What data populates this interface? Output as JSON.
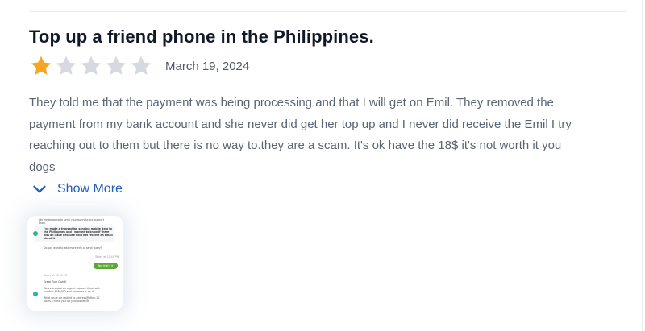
{
  "review": {
    "title": "Top up a friend phone in the Philippines.",
    "rating": 1,
    "max_rating": 5,
    "date": "March 19, 2024",
    "body_lines": [
      "They told me that the payment was being processing and that I will get on Emil. They removed the",
      "payment from my bank account and she never did get her top up and I never did receive the Emil I try",
      "reaching out to them but there is no way to.they are a scam. It's ok have the 18$ it's not worth it you",
      "dogs"
    ],
    "show_more_label": "Show More"
  },
  "icons": {
    "filled_star": "star-filled-icon",
    "empty_star": "star-empty-icon",
    "show_more": "chevron-down-icon"
  },
  "colors": {
    "star_filled": "#f5a623",
    "star_empty": "#d6d9de",
    "link": "#1f5fbf",
    "chat_green": "#5aa82f"
  },
  "attachment": {
    "lines": [
      "Let me be going to send your query to our support",
      "team.",
      "I've made a transaction sending mobile data to",
      "the Philippines and I wanted to know if there",
      "was an issue because I did not receive an email",
      "about it",
      "Do you want to add more info or send query?",
      "Today at 12:45 PM",
      "No, that's it",
      "Today at 12:45 PM",
      "Great Zurk Quint!",
      "We've created an urgent support ticket with",
      "number 4780310 and someone is on it!",
      "What issue we replied to address@other.10",
      "hours. Thank you for your patience!"
    ]
  }
}
